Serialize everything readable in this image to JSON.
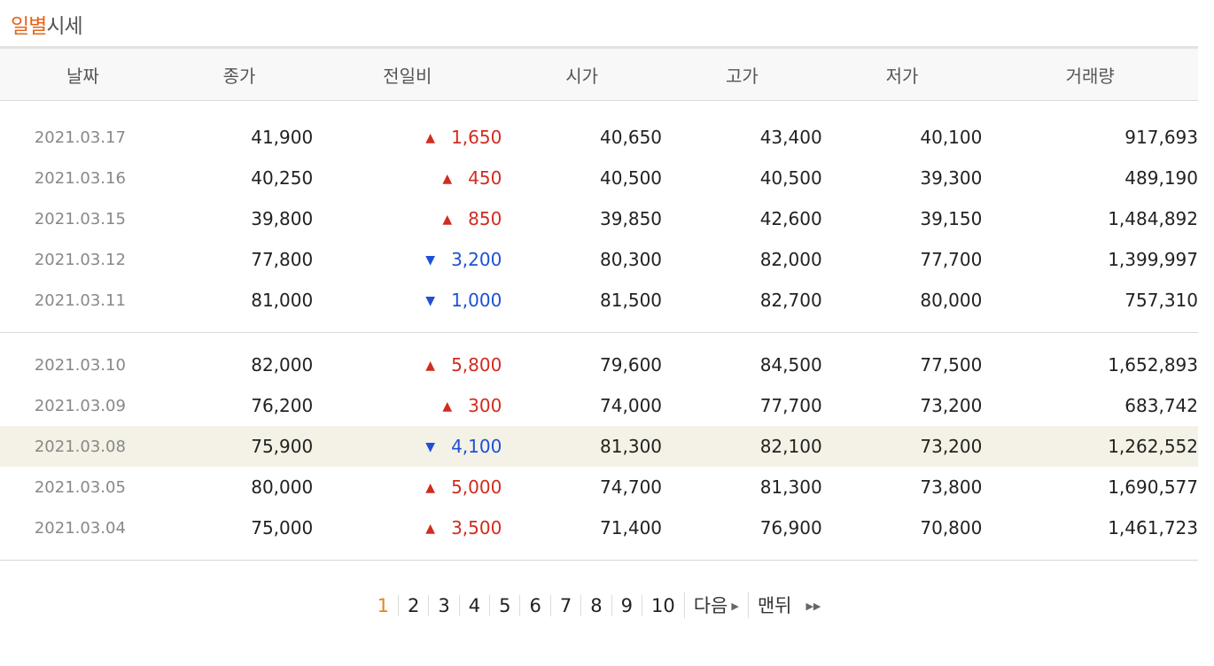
{
  "title": {
    "accent": "일별",
    "rest": "시세"
  },
  "columns": [
    "날짜",
    "종가",
    "전일비",
    "시가",
    "고가",
    "저가",
    "거래량"
  ],
  "rows": [
    {
      "date": "2021.03.17",
      "close": "41,900",
      "dir": "up",
      "change": "1,650",
      "open": "40,650",
      "high": "43,400",
      "low": "40,100",
      "volume": "917,693"
    },
    {
      "date": "2021.03.16",
      "close": "40,250",
      "dir": "up",
      "change": "450",
      "open": "40,500",
      "high": "40,500",
      "low": "39,300",
      "volume": "489,190"
    },
    {
      "date": "2021.03.15",
      "close": "39,800",
      "dir": "up",
      "change": "850",
      "open": "39,850",
      "high": "42,600",
      "low": "39,150",
      "volume": "1,484,892"
    },
    {
      "date": "2021.03.12",
      "close": "77,800",
      "dir": "down",
      "change": "3,200",
      "open": "80,300",
      "high": "82,000",
      "low": "77,700",
      "volume": "1,399,997"
    },
    {
      "date": "2021.03.11",
      "close": "81,000",
      "dir": "down",
      "change": "1,000",
      "open": "81,500",
      "high": "82,700",
      "low": "80,000",
      "volume": "757,310"
    },
    {
      "date": "2021.03.10",
      "close": "82,000",
      "dir": "up",
      "change": "5,800",
      "open": "79,600",
      "high": "84,500",
      "low": "77,500",
      "volume": "1,652,893"
    },
    {
      "date": "2021.03.09",
      "close": "76,200",
      "dir": "up",
      "change": "300",
      "open": "74,000",
      "high": "77,700",
      "low": "73,200",
      "volume": "683,742"
    },
    {
      "date": "2021.03.08",
      "close": "75,900",
      "dir": "down",
      "change": "4,100",
      "open": "81,300",
      "high": "82,100",
      "low": "73,200",
      "volume": "1,262,552"
    },
    {
      "date": "2021.03.05",
      "close": "80,000",
      "dir": "up",
      "change": "5,000",
      "open": "74,700",
      "high": "81,300",
      "low": "73,800",
      "volume": "1,690,577"
    },
    {
      "date": "2021.03.04",
      "close": "75,000",
      "dir": "up",
      "change": "3,500",
      "open": "71,400",
      "high": "76,900",
      "low": "70,800",
      "volume": "1,461,723"
    }
  ],
  "highlighted_row": "2021.03.08",
  "icons": {
    "up": "triangle-up-icon",
    "down": "triangle-down-icon"
  },
  "colors": {
    "accent": "#e5641c",
    "up": "#d12c20",
    "down": "#1e50d8",
    "highlight": "#f4f2e6"
  },
  "pagination": {
    "current": "1",
    "pages": [
      "1",
      "2",
      "3",
      "4",
      "5",
      "6",
      "7",
      "8",
      "9",
      "10"
    ],
    "next_label": "다음",
    "last_label": "맨뒤"
  }
}
